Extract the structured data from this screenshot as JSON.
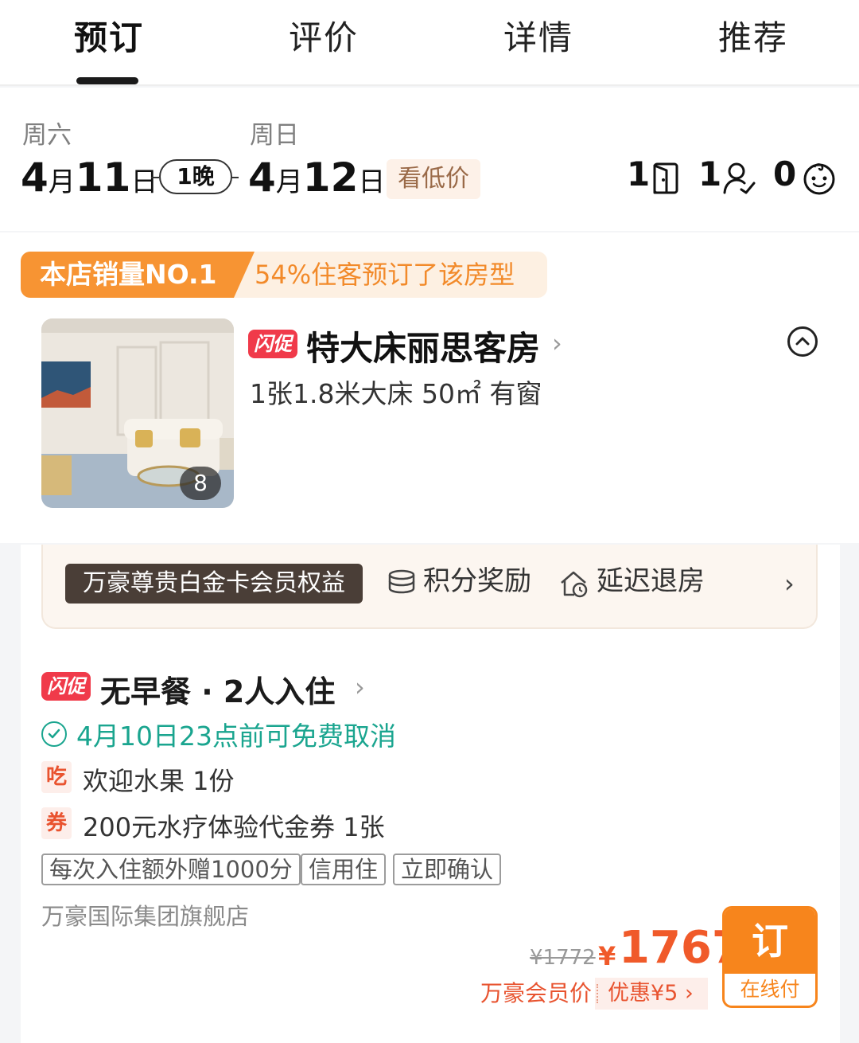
{
  "tabs": [
    {
      "label": "预订"
    },
    {
      "label": "评价"
    },
    {
      "label": "详情"
    },
    {
      "label": "推荐"
    }
  ],
  "stay": {
    "checkin_weekday": "周六",
    "checkin_month": "4",
    "checkin_day": "11",
    "checkout_weekday": "周日",
    "checkout_month": "4",
    "checkout_day": "12",
    "month_unit": "月",
    "day_unit": "日",
    "nights": "1晚",
    "low_price_label": "看低价",
    "rooms": "1",
    "adults": "1",
    "children": "0"
  },
  "room": {
    "sales_badge": "本店销量NO.1",
    "sales_note": "54%住客预订了该房型",
    "flash_label": "闪促",
    "name": "特大床丽思客房",
    "spec": "1张1.8米大床  50㎡  有窗",
    "photo_count": "8"
  },
  "member_benefits": {
    "tier": "万豪尊贵白金卡会员权益",
    "perk1": "积分奖励",
    "perk2": "延迟退房"
  },
  "rate": {
    "flash_label": "闪促",
    "title": "无早餐 · 2人入住",
    "cancel_policy": "4月10日23点前可免费取消",
    "gift1_icon": "吃",
    "gift1": "欢迎水果 1份",
    "gift2_icon": "券",
    "gift2": "200元水疗体验代金券 1张",
    "tags": [
      "每次入住额外赠1000分",
      "信用住",
      "立即确认"
    ],
    "store": "万豪国际集团旗舰店",
    "original_price": "¥1772",
    "currency": "¥",
    "price": "1767",
    "member_price_label": "万豪会员价",
    "discount": "优惠¥5",
    "book_label": "订",
    "pay_label": "在线付"
  },
  "colors": {
    "accent": "#f7851c",
    "price": "#f05a2a",
    "cancel": "#1aa58f",
    "flash": "#f03a4a"
  }
}
